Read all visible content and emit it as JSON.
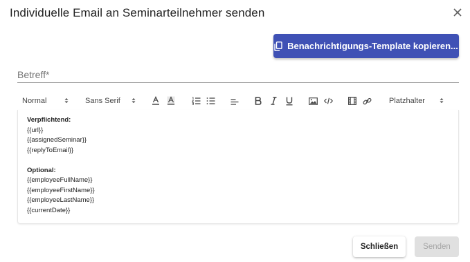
{
  "dialog": {
    "title": "Individuelle Email an Seminarteilnehmer senden",
    "close_icon": "close-icon"
  },
  "copy_button": {
    "label": "Benachrichtigungs-Template kopieren...",
    "icon": "copy-icon"
  },
  "subject": {
    "placeholder": "Betreff*",
    "value": ""
  },
  "toolbar": {
    "size_select": "Normal",
    "font_select": "Sans Serif",
    "placeholder_select": "Platzhalter",
    "icons": [
      "font-color-icon",
      "background-color-icon",
      "ordered-list-icon",
      "bullet-list-icon",
      "align-icon",
      "bold-icon",
      "italic-icon",
      "underline-icon",
      "image-icon",
      "code-icon",
      "video-icon",
      "link-icon"
    ]
  },
  "editor": {
    "required_heading": "Verpflichtend:",
    "required_items": [
      "{{url}}",
      "{{assignedSeminar}}",
      "{{replyToEmail}}"
    ],
    "optional_heading": "Optional:",
    "optional_items": [
      "{{employeeFullName}}",
      "{{employeeFirstName}}",
      "{{employeeLastName}}",
      "{{currentDate}}"
    ]
  },
  "footer": {
    "cancel_label": "Schließen",
    "send_label": "Senden"
  },
  "colors": {
    "primary": "#3f51b5",
    "disabled_bg": "#e0e0e0",
    "disabled_text": "#a6a6a6"
  }
}
